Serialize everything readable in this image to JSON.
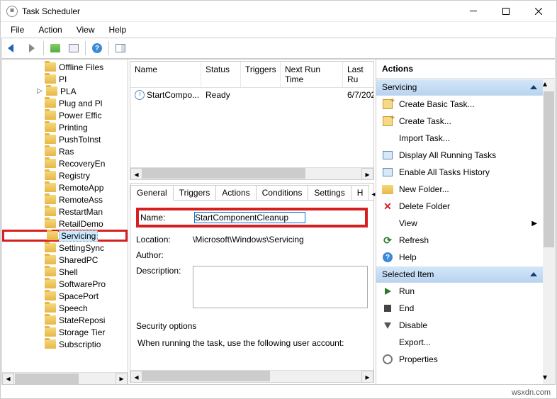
{
  "window": {
    "title": "Task Scheduler"
  },
  "menu": {
    "file": "File",
    "action": "Action",
    "view": "View",
    "help": "Help"
  },
  "tree": {
    "items": [
      {
        "label": "Offline Files"
      },
      {
        "label": "PI"
      },
      {
        "label": "PLA",
        "expandable": true
      },
      {
        "label": "Plug and Pl"
      },
      {
        "label": "Power Effic"
      },
      {
        "label": "Printing"
      },
      {
        "label": "PushToInst"
      },
      {
        "label": "Ras"
      },
      {
        "label": "RecoveryEn"
      },
      {
        "label": "Registry"
      },
      {
        "label": "RemoteApp"
      },
      {
        "label": "RemoteAss"
      },
      {
        "label": "RestartMan"
      },
      {
        "label": "RetailDemo"
      },
      {
        "label": "Servicing",
        "selected": true,
        "highlighted": true
      },
      {
        "label": "SettingSync"
      },
      {
        "label": "SharedPC"
      },
      {
        "label": "Shell"
      },
      {
        "label": "SoftwarePro"
      },
      {
        "label": "SpacePort"
      },
      {
        "label": "Speech"
      },
      {
        "label": "StateReposi"
      },
      {
        "label": "Storage Tier"
      },
      {
        "label": "Subscriptio"
      }
    ]
  },
  "tasklist": {
    "columns": {
      "name": "Name",
      "status": "Status",
      "triggers": "Triggers",
      "next": "Next Run Time",
      "last": "Last Ru"
    },
    "row": {
      "name": "StartCompo...",
      "status": "Ready",
      "triggers": "",
      "next": "",
      "last": "6/7/202"
    }
  },
  "tabs": {
    "general": "General",
    "triggers": "Triggers",
    "actions": "Actions",
    "conditions": "Conditions",
    "settings": "Settings",
    "history": "H"
  },
  "details": {
    "name_label": "Name:",
    "name_value": "StartComponentCleanup",
    "location_label": "Location:",
    "location_value": "\\Microsoft\\Windows\\Servicing",
    "author_label": "Author:",
    "description_label": "Description:",
    "security_label": "Security options",
    "security_text": "When running the task, use the following user account:"
  },
  "actions": {
    "header": "Actions",
    "section1": "Servicing",
    "section2": "Selected Item",
    "items1": {
      "create_basic": "Create Basic Task...",
      "create": "Create Task...",
      "import": "Import Task...",
      "display": "Display All Running Tasks",
      "enable_hist": "Enable All Tasks History",
      "new_folder": "New Folder...",
      "delete_folder": "Delete Folder",
      "view": "View",
      "refresh": "Refresh",
      "help": "Help"
    },
    "items2": {
      "run": "Run",
      "end": "End",
      "disable": "Disable",
      "export": "Export...",
      "properties": "Properties"
    }
  },
  "footer": "wsxdn.com"
}
